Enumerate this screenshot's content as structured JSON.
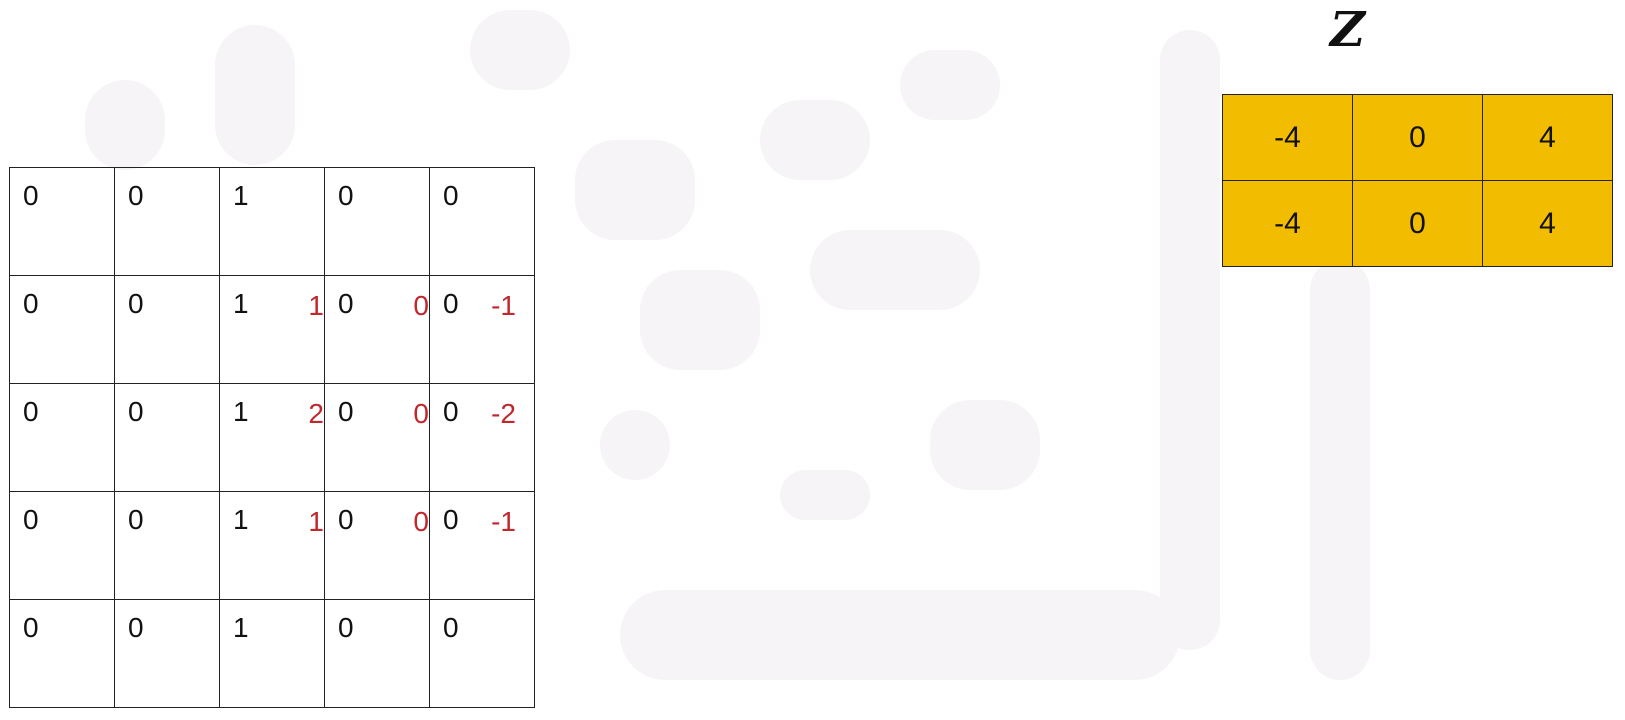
{
  "input_grid": {
    "values": [
      [
        "0",
        "0",
        "1",
        "0",
        "0"
      ],
      [
        "0",
        "0",
        "1",
        "0",
        "0"
      ],
      [
        "0",
        "0",
        "1",
        "0",
        "0"
      ],
      [
        "0",
        "0",
        "1",
        "0",
        "0"
      ],
      [
        "0",
        "0",
        "1",
        "0",
        "0"
      ]
    ],
    "kernel_overlay": [
      [
        "1",
        "0",
        "-1"
      ],
      [
        "2",
        "0",
        "-2"
      ],
      [
        "1",
        "0",
        "-1"
      ]
    ],
    "kernel_color": "#c0282d"
  },
  "output": {
    "title": "Z",
    "fill_color": "#f2bc00",
    "values": [
      [
        "-4",
        "0",
        "4"
      ],
      [
        "-4",
        "0",
        "4"
      ]
    ]
  }
}
